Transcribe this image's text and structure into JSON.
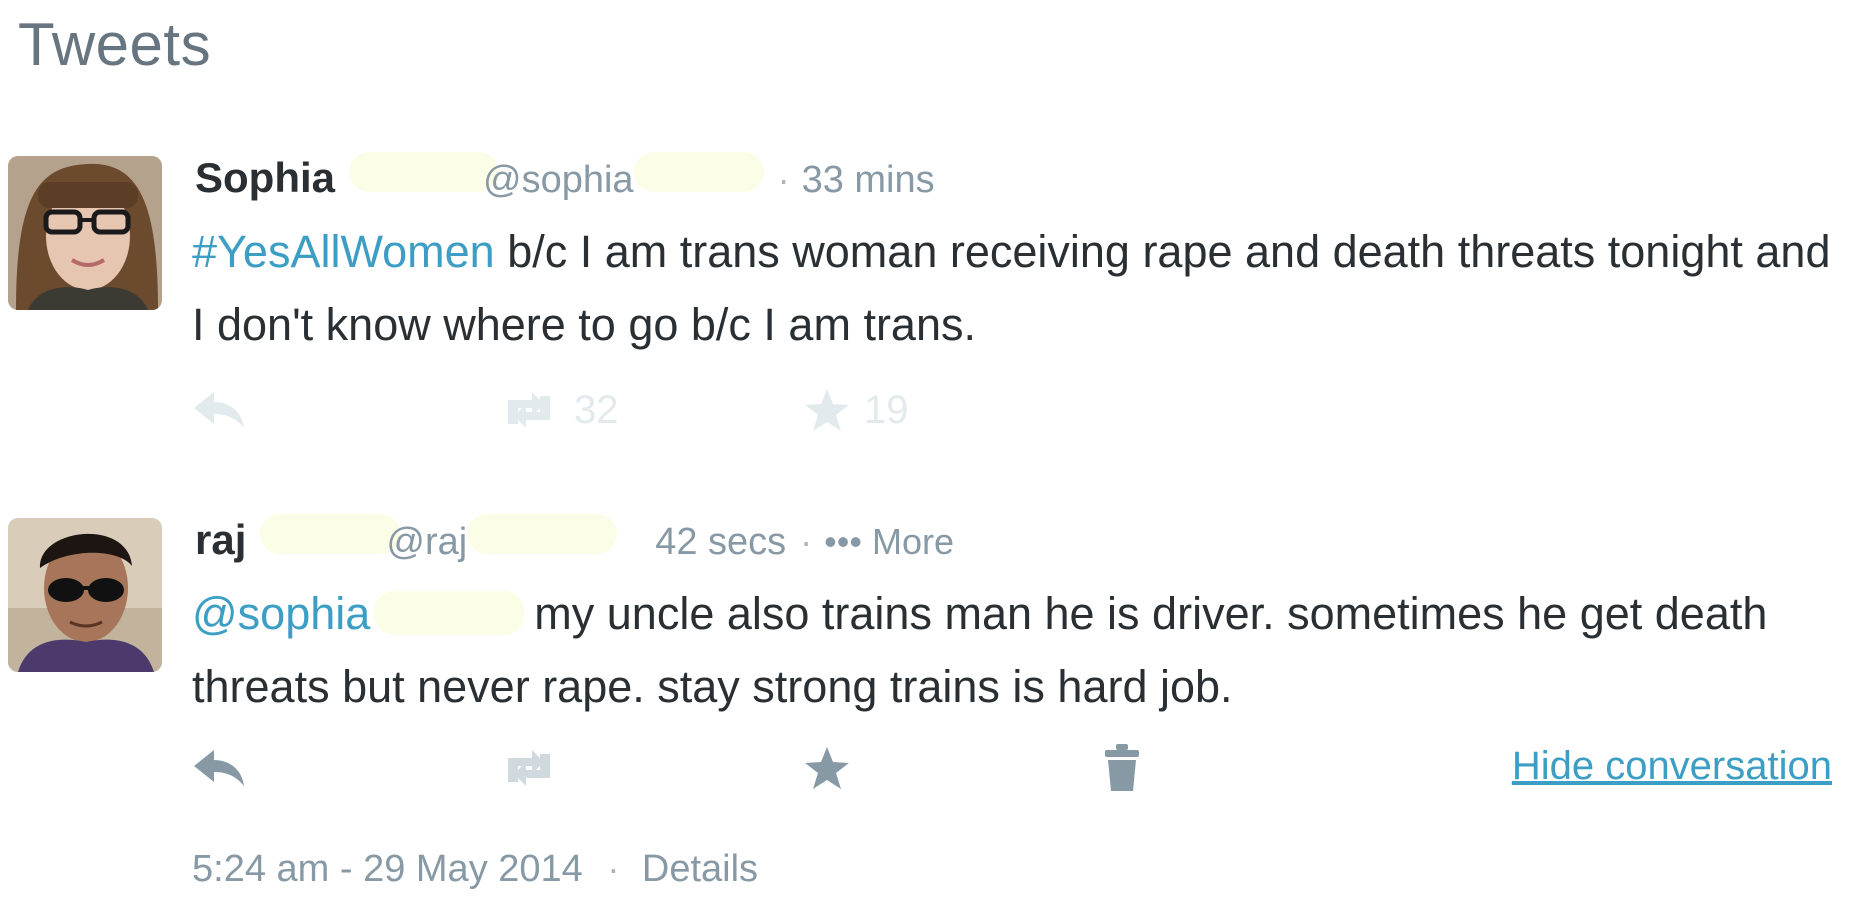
{
  "section": {
    "title": "Tweets"
  },
  "tweets": [
    {
      "name": "Sophia",
      "handle": "@sophia",
      "separator": "·",
      "time": "33 mins",
      "hashtag": "#YesAllWomen",
      "text_rest": " b/c I am trans woman receiving rape and death threats tonight  and I don't know where to go b/c I am trans.",
      "retweets": "32",
      "favorites": "19"
    },
    {
      "name": "raj",
      "handle": "@raj",
      "separator": "·",
      "time": "42 secs",
      "more_label": "••• More",
      "mention": "@sophia",
      "text_rest": "my uncle also trains man he is driver. sometimes he get death threats but never rape. stay strong trains is hard job.",
      "hide_label": "Hide conversation",
      "timestamp": "5:24 am - 29 May 2014",
      "details_label": "Details"
    }
  ],
  "colors": {
    "link": "#3c9ec4",
    "muted": "#8899a6",
    "faded_icon": "#e3eaee",
    "active_icon": "#8899a6",
    "redaction": "#fbfde6"
  },
  "icons": {
    "reply": "reply-arrow-icon",
    "retweet": "retweet-icon",
    "favorite": "star-icon",
    "delete": "trash-icon"
  }
}
